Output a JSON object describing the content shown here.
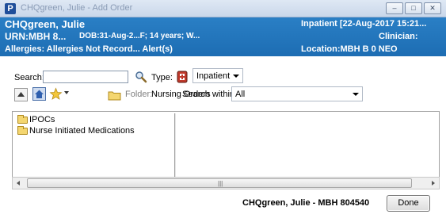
{
  "window": {
    "app_icon_letter": "P",
    "title": "CHQgreen, Julie - Add Order",
    "controls": [
      "–",
      "□",
      "✕"
    ]
  },
  "banner": {
    "patient_name": "CHQgreen, Julie",
    "urn": "URN:MBH 8...",
    "dob": "DOB:31-Aug-2...F; 14 years; W...",
    "allergies": "Allergies: Allergies Not Record... Alert(s)",
    "encounter": "Inpatient [22-Aug-2017 15:21...",
    "clinician": "Clinician:",
    "location": "Location:MBH B 0 NEO",
    "bg_color": "#1d6db3"
  },
  "search": {
    "label": "Search:",
    "value": "",
    "type_label": "Type:",
    "type_value": "Inpatient"
  },
  "folder_bar": {
    "folder_label": "Folder:",
    "folder_name": "Nursing Orders",
    "search_within_label": "Search within:",
    "search_within_value": "All"
  },
  "tree": {
    "items": [
      "IPOCs",
      "Nurse Initiated Medications"
    ]
  },
  "footer": {
    "patient_id": "CHQgreen, Julie - MBH 804540",
    "done_label": "Done"
  }
}
